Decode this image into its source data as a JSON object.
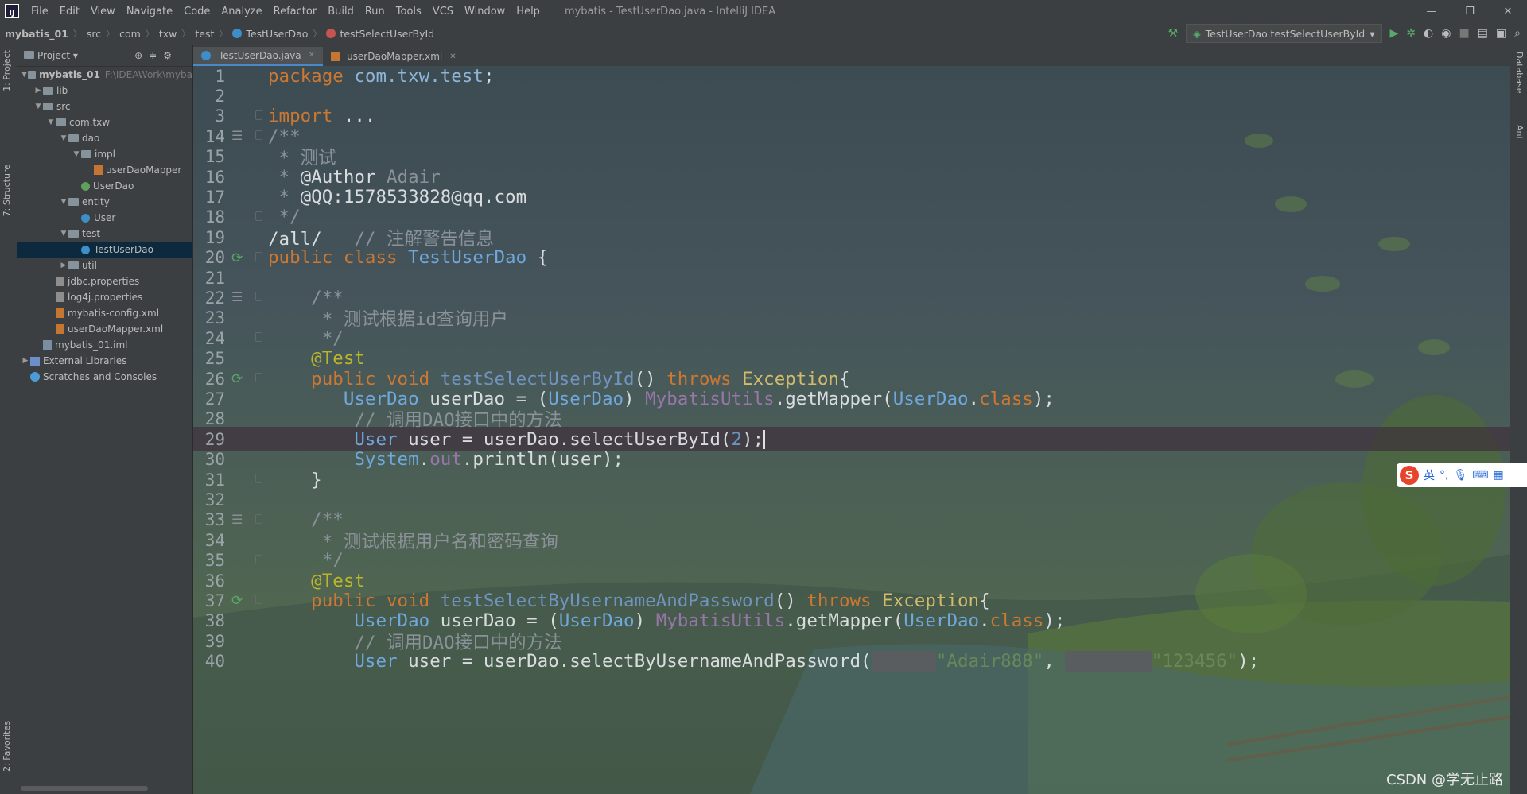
{
  "menubar": {
    "items": [
      "File",
      "Edit",
      "View",
      "Navigate",
      "Code",
      "Analyze",
      "Refactor",
      "Build",
      "Run",
      "Tools",
      "VCS",
      "Window",
      "Help"
    ],
    "window_title": "mybatis - TestUserDao.java - IntelliJ IDEA",
    "controls": [
      "—",
      "❐",
      "✕"
    ]
  },
  "breadcrumb": {
    "items": [
      "mybatis_01",
      "src",
      "com",
      "txw",
      "test",
      "TestUserDao",
      "testSelectUserById"
    ]
  },
  "run_config": {
    "label": "TestUserDao.testSelectUserById"
  },
  "left_stripe": {
    "project_tab": "1: Project",
    "structure_tab": "7: Structure",
    "favorites_tab": "2: Favorites"
  },
  "right_stripe": {
    "database_tab": "Database",
    "ant_tab": "Ant"
  },
  "project_panel": {
    "title": "Project",
    "tree": [
      {
        "label": "mybatis_01",
        "hint": "F:\\IDEAWork\\myba",
        "depth": 0,
        "arrow": "▼",
        "icon": "folder"
      },
      {
        "label": "lib",
        "depth": 1,
        "arrow": "▶",
        "icon": "folder"
      },
      {
        "label": "src",
        "depth": 1,
        "arrow": "▼",
        "icon": "folder"
      },
      {
        "label": "com.txw",
        "depth": 2,
        "arrow": "▼",
        "icon": "folder"
      },
      {
        "label": "dao",
        "depth": 3,
        "arrow": "▼",
        "icon": "folder"
      },
      {
        "label": "impl",
        "depth": 4,
        "arrow": "▼",
        "icon": "folder"
      },
      {
        "label": "userDaoMapper",
        "depth": 5,
        "arrow": "",
        "icon": "xml"
      },
      {
        "label": "UserDao",
        "depth": 4,
        "arrow": "",
        "icon": "interface"
      },
      {
        "label": "entity",
        "depth": 3,
        "arrow": "▼",
        "icon": "folder"
      },
      {
        "label": "User",
        "depth": 4,
        "arrow": "",
        "icon": "class"
      },
      {
        "label": "test",
        "depth": 3,
        "arrow": "▼",
        "icon": "folder"
      },
      {
        "label": "TestUserDao",
        "depth": 4,
        "arrow": "",
        "icon": "class",
        "selected": true
      },
      {
        "label": "util",
        "depth": 3,
        "arrow": "▶",
        "icon": "folder"
      },
      {
        "label": "jdbc.properties",
        "depth": 2,
        "arrow": "",
        "icon": "prop"
      },
      {
        "label": "log4j.properties",
        "depth": 2,
        "arrow": "",
        "icon": "prop"
      },
      {
        "label": "mybatis-config.xml",
        "depth": 2,
        "arrow": "",
        "icon": "xml"
      },
      {
        "label": "userDaoMapper.xml",
        "depth": 2,
        "arrow": "",
        "icon": "xml"
      },
      {
        "label": "mybatis_01.iml",
        "depth": 1,
        "arrow": "",
        "icon": "iml"
      },
      {
        "label": "External Libraries",
        "depth": 0,
        "arrow": "▶",
        "icon": "ext"
      },
      {
        "label": "Scratches and Consoles",
        "depth": 0,
        "arrow": "",
        "icon": "scratch"
      }
    ]
  },
  "editor_tabs": [
    {
      "label": "TestUserDao.java",
      "active": true,
      "icon": "class"
    },
    {
      "label": "userDaoMapper.xml",
      "active": false,
      "icon": "xml"
    }
  ],
  "code_lines": [
    {
      "n": "1",
      "gutter": "",
      "spans": [
        [
          "package ",
          "kw"
        ],
        [
          "com.txw.test",
          "pkg"
        ],
        [
          ";",
          "p"
        ]
      ]
    },
    {
      "n": "2",
      "gutter": "",
      "spans": []
    },
    {
      "n": "3",
      "gutter": "fold",
      "spans": [
        [
          "import ",
          "kw"
        ],
        [
          "...",
          "p"
        ]
      ]
    },
    {
      "n": "14",
      "gutter": "doc",
      "spans": [
        [
          "/**",
          "cm"
        ]
      ]
    },
    {
      "n": "15",
      "gutter": "",
      "spans": [
        [
          " * 测试",
          "cm"
        ]
      ]
    },
    {
      "n": "16",
      "gutter": "",
      "spans": [
        [
          " * ",
          "cm"
        ],
        [
          "@Author",
          "tag"
        ],
        [
          " Adair",
          "cm"
        ]
      ]
    },
    {
      "n": "17",
      "gutter": "",
      "spans": [
        [
          " * ",
          "cm"
        ],
        [
          "@QQ:1578533828@qq.com",
          "tag"
        ]
      ]
    },
    {
      "n": "18",
      "gutter": "fold",
      "spans": [
        [
          " */",
          "cm"
        ]
      ]
    },
    {
      "n": "19",
      "gutter": "",
      "spans": [
        [
          "/all/   ",
          "p"
        ],
        [
          "// 注解警告信息",
          "lc"
        ]
      ]
    },
    {
      "n": "20",
      "gutter": "run",
      "spans": [
        [
          "public class ",
          "kw"
        ],
        [
          "TestUserDao",
          "cls"
        ],
        [
          " {",
          "p"
        ]
      ]
    },
    {
      "n": "21",
      "gutter": "",
      "spans": []
    },
    {
      "n": "22",
      "gutter": "doc",
      "spans": [
        [
          "    /**",
          "cm"
        ]
      ]
    },
    {
      "n": "23",
      "gutter": "",
      "spans": [
        [
          "     * 测试根据id查询用户",
          "cm"
        ]
      ]
    },
    {
      "n": "24",
      "gutter": "fold",
      "spans": [
        [
          "     */",
          "cm"
        ]
      ]
    },
    {
      "n": "25",
      "gutter": "",
      "spans": [
        [
          "    @Test",
          "ann"
        ]
      ]
    },
    {
      "n": "26",
      "gutter": "run",
      "spans": [
        [
          "    public void ",
          "kw"
        ],
        [
          "testSelectUserById",
          "mth"
        ],
        [
          "() ",
          "p"
        ],
        [
          "throws ",
          "kw"
        ],
        [
          "Exception",
          "exc"
        ],
        [
          "{",
          "p"
        ]
      ]
    },
    {
      "n": "27",
      "gutter": "",
      "spans": [
        [
          "       ",
          "p"
        ],
        [
          "UserDao",
          "cls"
        ],
        [
          " userDao = (",
          "p"
        ],
        [
          "UserDao",
          "cls"
        ],
        [
          ") ",
          "p"
        ],
        [
          "MybatisUtils",
          "util"
        ],
        [
          ".getMapper(",
          "p"
        ],
        [
          "UserDao",
          "cls"
        ],
        [
          ".",
          "p"
        ],
        [
          "class",
          "kw"
        ],
        [
          ");",
          "p"
        ]
      ]
    },
    {
      "n": "28",
      "gutter": "",
      "spans": [
        [
          "        ",
          "p"
        ],
        [
          "// 调用DAO接口中的方法",
          "lc"
        ]
      ]
    },
    {
      "n": "29",
      "gutter": "",
      "current": true,
      "spans": [
        [
          "        ",
          "p"
        ],
        [
          "User",
          "cls"
        ],
        [
          " user = userDao.selectUserById(",
          "p"
        ],
        [
          "2",
          "num"
        ],
        [
          ");",
          "p"
        ]
      ]
    },
    {
      "n": "30",
      "gutter": "",
      "spans": [
        [
          "        ",
          "p"
        ],
        [
          "System",
          "cls"
        ],
        [
          ".",
          "p"
        ],
        [
          "out",
          "util"
        ],
        [
          ".println(user);",
          "p"
        ]
      ]
    },
    {
      "n": "31",
      "gutter": "fold",
      "spans": [
        [
          "    }",
          "p"
        ]
      ]
    },
    {
      "n": "32",
      "gutter": "",
      "spans": []
    },
    {
      "n": "33",
      "gutter": "doc",
      "spans": [
        [
          "    /**",
          "cm"
        ]
      ]
    },
    {
      "n": "34",
      "gutter": "",
      "spans": [
        [
          "     * 测试根据用户名和密码查询",
          "cm"
        ]
      ]
    },
    {
      "n": "35",
      "gutter": "fold",
      "spans": [
        [
          "     */",
          "cm"
        ]
      ]
    },
    {
      "n": "36",
      "gutter": "",
      "spans": [
        [
          "    @Test",
          "ann"
        ]
      ]
    },
    {
      "n": "37",
      "gutter": "run",
      "spans": [
        [
          "    public void ",
          "kw"
        ],
        [
          "testSelectByUsernameAndPassword",
          "mth"
        ],
        [
          "() ",
          "p"
        ],
        [
          "throws ",
          "kw"
        ],
        [
          "Exception",
          "exc"
        ],
        [
          "{",
          "p"
        ]
      ]
    },
    {
      "n": "38",
      "gutter": "",
      "spans": [
        [
          "        ",
          "p"
        ],
        [
          "UserDao",
          "cls"
        ],
        [
          " userDao = (",
          "p"
        ],
        [
          "UserDao",
          "cls"
        ],
        [
          ") ",
          "p"
        ],
        [
          "MybatisUtils",
          "util"
        ],
        [
          ".getMapper(",
          "p"
        ],
        [
          "UserDao",
          "cls"
        ],
        [
          ".",
          "p"
        ],
        [
          "class",
          "kw"
        ],
        [
          ");",
          "p"
        ]
      ]
    },
    {
      "n": "39",
      "gutter": "",
      "spans": [
        [
          "        ",
          "p"
        ],
        [
          "// 调用DAO接口中的方法",
          "lc"
        ]
      ]
    },
    {
      "n": "40",
      "gutter": "",
      "spans": [
        [
          "        ",
          "p"
        ],
        [
          "User",
          "cls"
        ],
        [
          " user = userDao.selectByUsernameAndPassword(",
          "p"
        ],
        [
          "      ",
          "hint"
        ],
        [
          "\"Adair888\"",
          "str"
        ],
        [
          ", ",
          "p"
        ],
        [
          "        ",
          "hint"
        ],
        [
          "\"123456\"",
          "str"
        ],
        [
          ");",
          "p"
        ]
      ]
    }
  ],
  "syntax_colors": {
    "kw": "#cc7832",
    "pkg": "#8fb5d6",
    "p": "#d8dcde",
    "cm": "#8a9199",
    "tag": "#d8dcde",
    "lc": "#8a9199",
    "cls": "#6ea8dc",
    "mth": "#6f94c0",
    "exc": "#d1bc6a",
    "ann": "#bbb529",
    "util": "#9876aa",
    "num": "#6897bb",
    "str": "#6a8759",
    "hint": "#6b6e70"
  },
  "ime": {
    "logo": "S",
    "mode": "英"
  },
  "watermark": "CSDN @学无止路"
}
